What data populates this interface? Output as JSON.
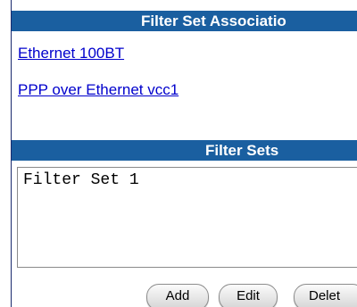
{
  "associations": {
    "header": "Filter Set Associatio",
    "links": [
      "Ethernet 100BT",
      "PPP over Ethernet vcc1"
    ]
  },
  "filter_sets": {
    "header": "Filter Sets",
    "items": [
      "Filter Set 1"
    ]
  },
  "buttons": {
    "add": "Add",
    "edit": "Edit",
    "delete": "Delet"
  },
  "colors": {
    "header_bg": "#1a5fa0",
    "link": "#0000cc"
  }
}
